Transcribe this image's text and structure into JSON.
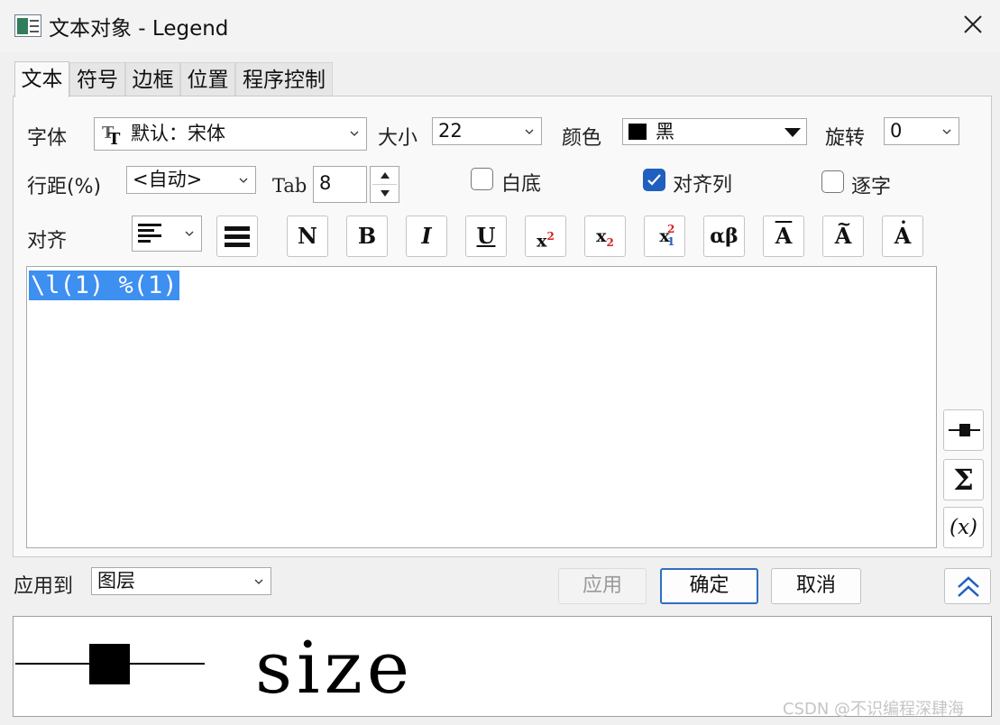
{
  "window": {
    "title": "文本对象 - Legend"
  },
  "tabs": [
    {
      "label": "文本",
      "active": true
    },
    {
      "label": "符号"
    },
    {
      "label": "边框"
    },
    {
      "label": "位置"
    },
    {
      "label": "程序控制"
    }
  ],
  "font": {
    "label": "字体",
    "value": "默认：宋体"
  },
  "size": {
    "label": "大小",
    "value": "22"
  },
  "color": {
    "label": "颜色",
    "value": "黑",
    "swatch": "#000000"
  },
  "rotate": {
    "label": "旋转",
    "value": "0"
  },
  "line_spacing": {
    "label": "行距(%)",
    "value": "<自动>"
  },
  "tab": {
    "label": "Tab",
    "value": "8"
  },
  "checkboxes": {
    "white_bg": {
      "label": "白底",
      "checked": false
    },
    "align_cols": {
      "label": "对齐列",
      "checked": true
    },
    "per_char": {
      "label": "逐字",
      "checked": false
    }
  },
  "align": {
    "label": "对齐"
  },
  "format_buttons": {
    "normal": "N",
    "bold": "B",
    "italic": "I",
    "underline": "U",
    "x": "x",
    "two": "2",
    "one": "1",
    "greek": "αβ",
    "a": "A"
  },
  "editor": {
    "text": "\\l(1) %(1)"
  },
  "side_buttons": {
    "sigma": "Σ",
    "function": "(x)"
  },
  "apply_to": {
    "label": "应用到",
    "value": "图层"
  },
  "buttons": {
    "apply": "应用",
    "ok": "确定",
    "cancel": "取消"
  },
  "preview": {
    "word": "size"
  },
  "watermark": "CSDN @不识编程深肆海",
  "colors": {
    "accent": "#1f5fbf",
    "selection": "#3d8ff0",
    "subscript_red": "#d62020",
    "subscript_blue": "#1f5fbf"
  }
}
